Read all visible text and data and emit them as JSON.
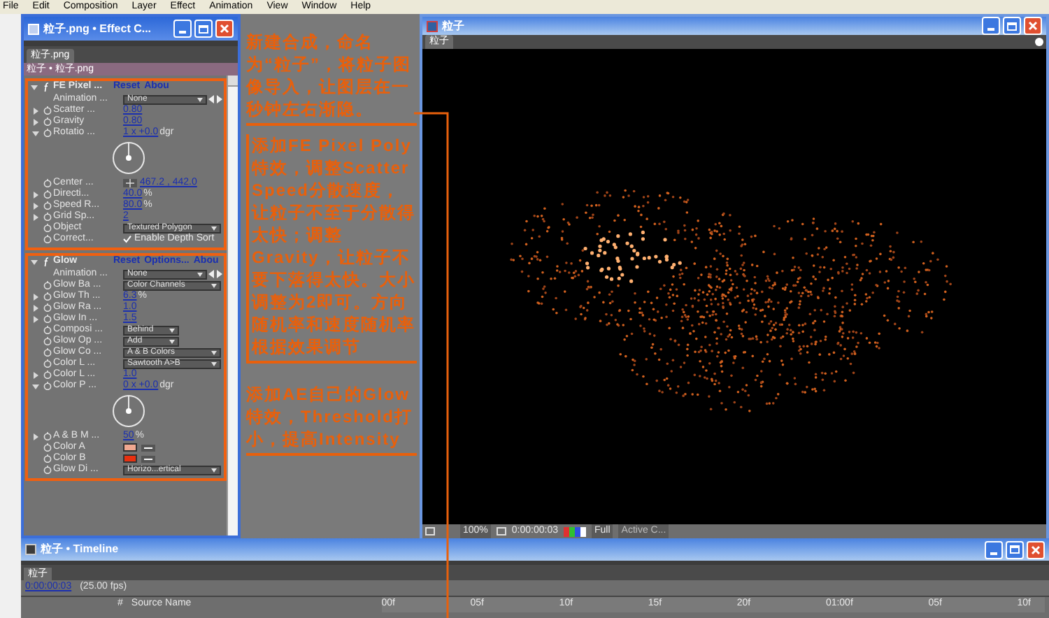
{
  "menu_bar": [
    "File",
    "Edit",
    "Composition",
    "Layer",
    "Effect",
    "Animation",
    "View",
    "Window",
    "Help"
  ],
  "effect_controls": {
    "title": "粒子.png • Effect C...",
    "tab": "粒子.png",
    "breadcrumb": "粒子 • 粒子.png",
    "effects": [
      {
        "name": "FE Pixel ...",
        "links": [
          "Reset",
          "Abou"
        ],
        "rows": [
          {
            "kind": "animation",
            "label": "Animation ...",
            "value": "None"
          },
          {
            "kind": "value",
            "twirl_open": false,
            "label": "Scatter ...",
            "value": "0.80"
          },
          {
            "kind": "value",
            "twirl_open": false,
            "label": "Gravity",
            "value": "0.80"
          },
          {
            "kind": "angle",
            "twirl_open": true,
            "label": "Rotatio ...",
            "value": "1 x +0.0",
            "unit": "dgr"
          },
          {
            "kind": "point",
            "label": "Center ...",
            "value": "467.2 , 442.0"
          },
          {
            "kind": "value",
            "twirl_open": false,
            "label": "Directi...",
            "value": "40.0",
            "unit": "%"
          },
          {
            "kind": "value",
            "twirl_open": false,
            "label": "Speed R...",
            "value": "80.0",
            "unit": "%"
          },
          {
            "kind": "value",
            "twirl_open": false,
            "label": "Grid Sp...",
            "value": "2"
          },
          {
            "kind": "dropdown",
            "label": "Object",
            "value": "Textured Polygon"
          },
          {
            "kind": "checkbox",
            "label": "Correct...",
            "value": "Enable Depth Sort",
            "checked": true
          }
        ]
      },
      {
        "name": "Glow",
        "links": [
          "Reset",
          "Options...",
          "Abou"
        ],
        "rows": [
          {
            "kind": "animation",
            "label": "Animation ...",
            "value": "None"
          },
          {
            "kind": "dropdown",
            "label": "Glow Ba ...",
            "value": "Color Channels"
          },
          {
            "kind": "value",
            "twirl_open": false,
            "label": "Glow Th ...",
            "value": "6.3",
            "unit": "%"
          },
          {
            "kind": "value",
            "twirl_open": false,
            "label": "Glow Ra ...",
            "value": "1.0"
          },
          {
            "kind": "value",
            "twirl_open": false,
            "label": "Glow In ...",
            "value": "1.5"
          },
          {
            "kind": "dropdown",
            "label": "Composi ...",
            "value": "Behind"
          },
          {
            "kind": "dropdown",
            "label": "Glow Op ...",
            "value": "Add"
          },
          {
            "kind": "dropdown",
            "label": "Glow Co ...",
            "value": "A & B Colors"
          },
          {
            "kind": "dropdown",
            "label": "Color L ...",
            "value": "Sawtooth A>B"
          },
          {
            "kind": "value",
            "twirl_open": false,
            "label": "Color L ...",
            "value": "1.0"
          },
          {
            "kind": "angle",
            "twirl_open": true,
            "label": "Color P ...",
            "value": "0 x +0.0",
            "unit": "dgr"
          },
          {
            "kind": "value",
            "twirl_open": false,
            "label": "A & B M ...",
            "value": "50",
            "unit": "%"
          },
          {
            "kind": "color",
            "label": "Color A",
            "color": "#f0a890"
          },
          {
            "kind": "color",
            "label": "Color B",
            "color": "#e83010"
          },
          {
            "kind": "dropdown",
            "label": "Glow Di ...",
            "value": "Horizo...ertical"
          }
        ]
      }
    ]
  },
  "annotations": [
    "新建合成，命名为“粒子”，将粒子图像导入，让图层在一秒钟左右渐隐。",
    "添加FE Pixel Poly特效，调整Scatter Speed分散速度，让粒子不至于分散得太快；调整Gravity，让粒子不要下落得太快。大小调整为2即可。方向随机率和速度随机率根据效果调节",
    "添加AE自己的Glow特效，Threshold打小，提高Intensity"
  ],
  "composition": {
    "title": "粒子",
    "tab": "粒子",
    "toolbar": {
      "zoom": "100%",
      "time": "0:00:00:03",
      "resolution": "Full",
      "camera": "Active C..."
    }
  },
  "timeline": {
    "title": "粒子 • Timeline",
    "tab": "粒子",
    "time": "0:00:00:03",
    "fps": "(25.00 fps)",
    "columns": [
      "#",
      "Source Name"
    ],
    "ruler": [
      "00f",
      "05f",
      "10f",
      "15f",
      "20f",
      "01:00f",
      "05f",
      "10f"
    ]
  }
}
